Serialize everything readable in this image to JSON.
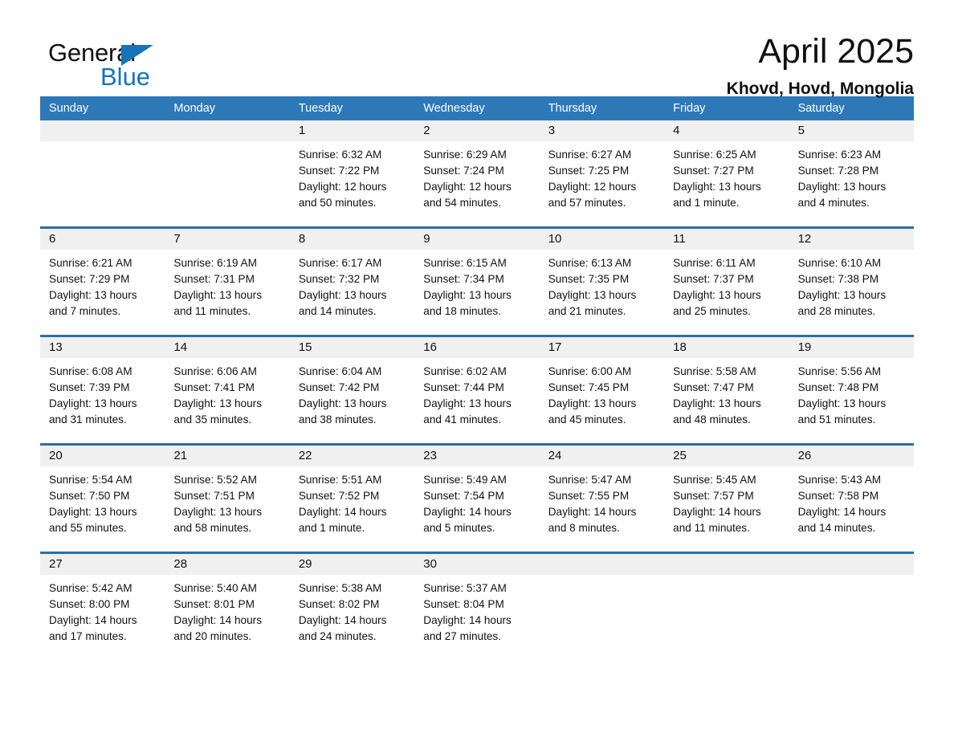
{
  "logo": {
    "word_dark": "General",
    "word_blue": "Blue",
    "triangle_color": "#1573ba"
  },
  "header": {
    "title": "April 2025",
    "location": "Khovd, Hovd, Mongolia"
  },
  "theme": {
    "header_blue": "#2d79b8",
    "row_rule_blue": "#2d6ea8",
    "daynum_band": "#f0f0f0"
  },
  "weekdays": [
    "Sunday",
    "Monday",
    "Tuesday",
    "Wednesday",
    "Thursday",
    "Friday",
    "Saturday"
  ],
  "weeks": [
    [
      {
        "day": "",
        "sunrise": "",
        "sunset": "",
        "daylight": ""
      },
      {
        "day": "",
        "sunrise": "",
        "sunset": "",
        "daylight": ""
      },
      {
        "day": "1",
        "sunrise": "Sunrise: 6:32 AM",
        "sunset": "Sunset: 7:22 PM",
        "daylight": "Daylight: 12 hours and 50 minutes."
      },
      {
        "day": "2",
        "sunrise": "Sunrise: 6:29 AM",
        "sunset": "Sunset: 7:24 PM",
        "daylight": "Daylight: 12 hours and 54 minutes."
      },
      {
        "day": "3",
        "sunrise": "Sunrise: 6:27 AM",
        "sunset": "Sunset: 7:25 PM",
        "daylight": "Daylight: 12 hours and 57 minutes."
      },
      {
        "day": "4",
        "sunrise": "Sunrise: 6:25 AM",
        "sunset": "Sunset: 7:27 PM",
        "daylight": "Daylight: 13 hours and 1 minute."
      },
      {
        "day": "5",
        "sunrise": "Sunrise: 6:23 AM",
        "sunset": "Sunset: 7:28 PM",
        "daylight": "Daylight: 13 hours and 4 minutes."
      }
    ],
    [
      {
        "day": "6",
        "sunrise": "Sunrise: 6:21 AM",
        "sunset": "Sunset: 7:29 PM",
        "daylight": "Daylight: 13 hours and 7 minutes."
      },
      {
        "day": "7",
        "sunrise": "Sunrise: 6:19 AM",
        "sunset": "Sunset: 7:31 PM",
        "daylight": "Daylight: 13 hours and 11 minutes."
      },
      {
        "day": "8",
        "sunrise": "Sunrise: 6:17 AM",
        "sunset": "Sunset: 7:32 PM",
        "daylight": "Daylight: 13 hours and 14 minutes."
      },
      {
        "day": "9",
        "sunrise": "Sunrise: 6:15 AM",
        "sunset": "Sunset: 7:34 PM",
        "daylight": "Daylight: 13 hours and 18 minutes."
      },
      {
        "day": "10",
        "sunrise": "Sunrise: 6:13 AM",
        "sunset": "Sunset: 7:35 PM",
        "daylight": "Daylight: 13 hours and 21 minutes."
      },
      {
        "day": "11",
        "sunrise": "Sunrise: 6:11 AM",
        "sunset": "Sunset: 7:37 PM",
        "daylight": "Daylight: 13 hours and 25 minutes."
      },
      {
        "day": "12",
        "sunrise": "Sunrise: 6:10 AM",
        "sunset": "Sunset: 7:38 PM",
        "daylight": "Daylight: 13 hours and 28 minutes."
      }
    ],
    [
      {
        "day": "13",
        "sunrise": "Sunrise: 6:08 AM",
        "sunset": "Sunset: 7:39 PM",
        "daylight": "Daylight: 13 hours and 31 minutes."
      },
      {
        "day": "14",
        "sunrise": "Sunrise: 6:06 AM",
        "sunset": "Sunset: 7:41 PM",
        "daylight": "Daylight: 13 hours and 35 minutes."
      },
      {
        "day": "15",
        "sunrise": "Sunrise: 6:04 AM",
        "sunset": "Sunset: 7:42 PM",
        "daylight": "Daylight: 13 hours and 38 minutes."
      },
      {
        "day": "16",
        "sunrise": "Sunrise: 6:02 AM",
        "sunset": "Sunset: 7:44 PM",
        "daylight": "Daylight: 13 hours and 41 minutes."
      },
      {
        "day": "17",
        "sunrise": "Sunrise: 6:00 AM",
        "sunset": "Sunset: 7:45 PM",
        "daylight": "Daylight: 13 hours and 45 minutes."
      },
      {
        "day": "18",
        "sunrise": "Sunrise: 5:58 AM",
        "sunset": "Sunset: 7:47 PM",
        "daylight": "Daylight: 13 hours and 48 minutes."
      },
      {
        "day": "19",
        "sunrise": "Sunrise: 5:56 AM",
        "sunset": "Sunset: 7:48 PM",
        "daylight": "Daylight: 13 hours and 51 minutes."
      }
    ],
    [
      {
        "day": "20",
        "sunrise": "Sunrise: 5:54 AM",
        "sunset": "Sunset: 7:50 PM",
        "daylight": "Daylight: 13 hours and 55 minutes."
      },
      {
        "day": "21",
        "sunrise": "Sunrise: 5:52 AM",
        "sunset": "Sunset: 7:51 PM",
        "daylight": "Daylight: 13 hours and 58 minutes."
      },
      {
        "day": "22",
        "sunrise": "Sunrise: 5:51 AM",
        "sunset": "Sunset: 7:52 PM",
        "daylight": "Daylight: 14 hours and 1 minute."
      },
      {
        "day": "23",
        "sunrise": "Sunrise: 5:49 AM",
        "sunset": "Sunset: 7:54 PM",
        "daylight": "Daylight: 14 hours and 5 minutes."
      },
      {
        "day": "24",
        "sunrise": "Sunrise: 5:47 AM",
        "sunset": "Sunset: 7:55 PM",
        "daylight": "Daylight: 14 hours and 8 minutes."
      },
      {
        "day": "25",
        "sunrise": "Sunrise: 5:45 AM",
        "sunset": "Sunset: 7:57 PM",
        "daylight": "Daylight: 14 hours and 11 minutes."
      },
      {
        "day": "26",
        "sunrise": "Sunrise: 5:43 AM",
        "sunset": "Sunset: 7:58 PM",
        "daylight": "Daylight: 14 hours and 14 minutes."
      }
    ],
    [
      {
        "day": "27",
        "sunrise": "Sunrise: 5:42 AM",
        "sunset": "Sunset: 8:00 PM",
        "daylight": "Daylight: 14 hours and 17 minutes."
      },
      {
        "day": "28",
        "sunrise": "Sunrise: 5:40 AM",
        "sunset": "Sunset: 8:01 PM",
        "daylight": "Daylight: 14 hours and 20 minutes."
      },
      {
        "day": "29",
        "sunrise": "Sunrise: 5:38 AM",
        "sunset": "Sunset: 8:02 PM",
        "daylight": "Daylight: 14 hours and 24 minutes."
      },
      {
        "day": "30",
        "sunrise": "Sunrise: 5:37 AM",
        "sunset": "Sunset: 8:04 PM",
        "daylight": "Daylight: 14 hours and 27 minutes."
      },
      {
        "day": "",
        "sunrise": "",
        "sunset": "",
        "daylight": ""
      },
      {
        "day": "",
        "sunrise": "",
        "sunset": "",
        "daylight": ""
      },
      {
        "day": "",
        "sunrise": "",
        "sunset": "",
        "daylight": ""
      }
    ]
  ]
}
